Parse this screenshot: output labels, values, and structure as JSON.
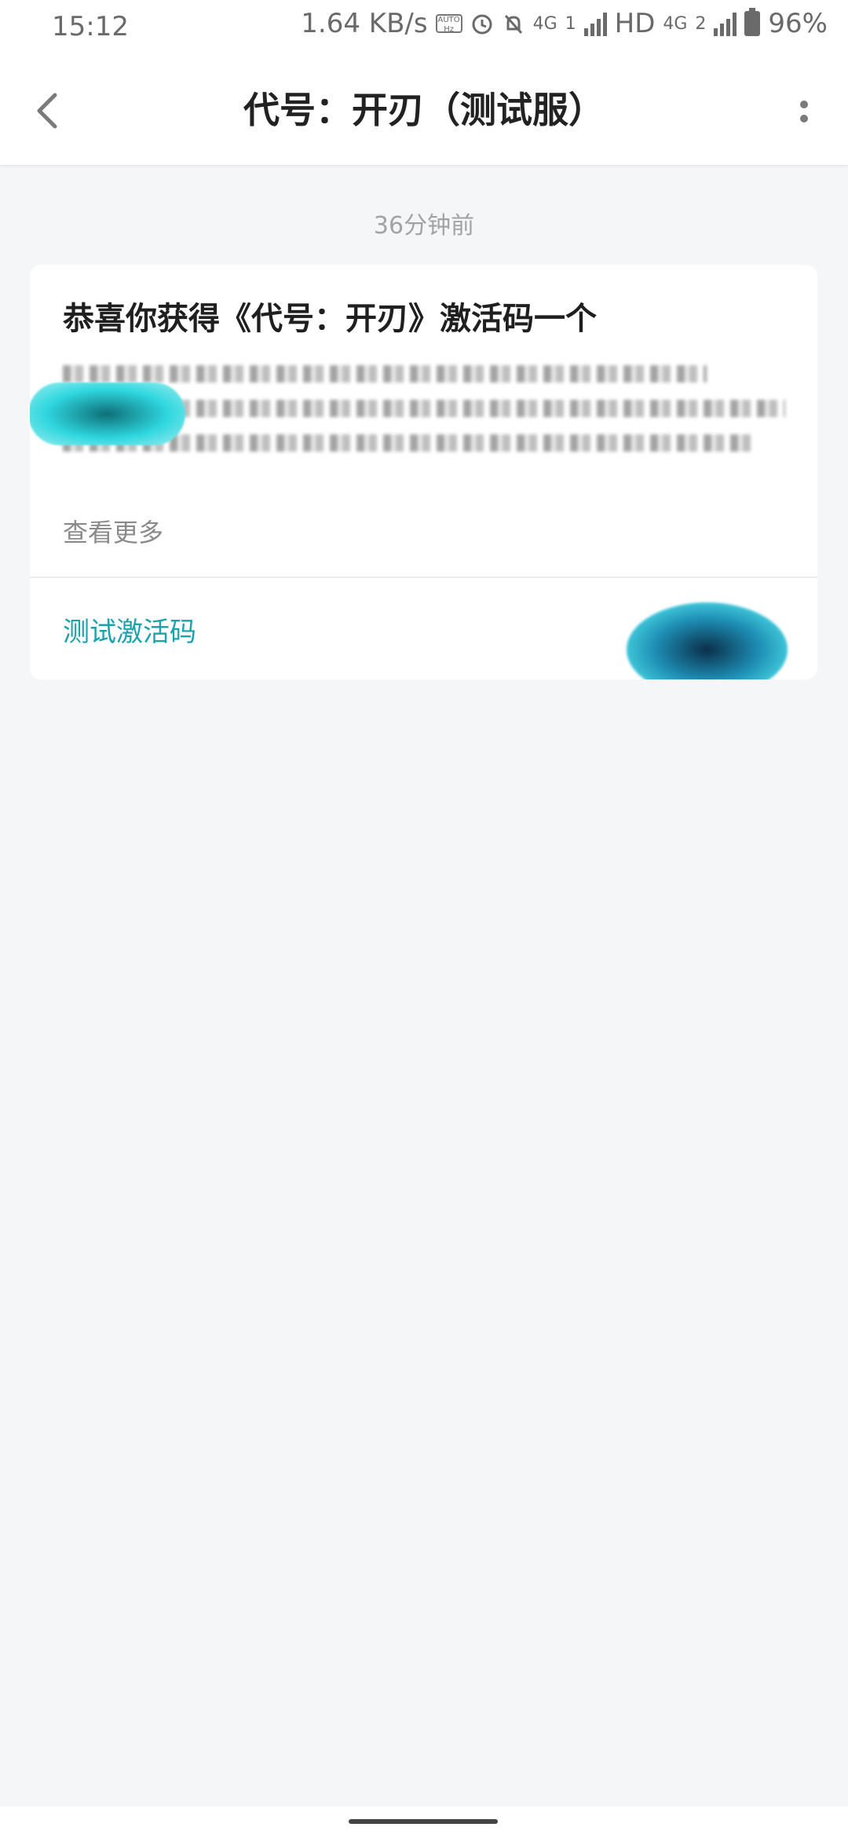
{
  "status_bar": {
    "time": "15:12",
    "network_speed": "1.64 KB/s",
    "refresh_badge": "AUTO Hz",
    "sim1_network": "4G",
    "sim1_badge": "1",
    "hd_label": "HD",
    "sim2_network": "4G",
    "sim2_badge": "2",
    "battery_percent": "96%",
    "icons": [
      "alarm-icon",
      "mute-notification-icon",
      "signal-icon",
      "battery-icon"
    ]
  },
  "header": {
    "title": "代号：开刃（测试服）",
    "back_icon": "chevron-left-icon",
    "more_icon": "more-vertical-icon"
  },
  "message": {
    "timestamp": "36分钟前",
    "title": "恭喜你获得《代号：开刃》激活码一个",
    "read_more": "查看更多",
    "action_link": "测试激活码"
  },
  "colors": {
    "accent": "#1aa3ad",
    "background": "#f5f6f8",
    "card": "#ffffff",
    "title_text": "#222222",
    "muted_text": "#8a8a8a"
  }
}
